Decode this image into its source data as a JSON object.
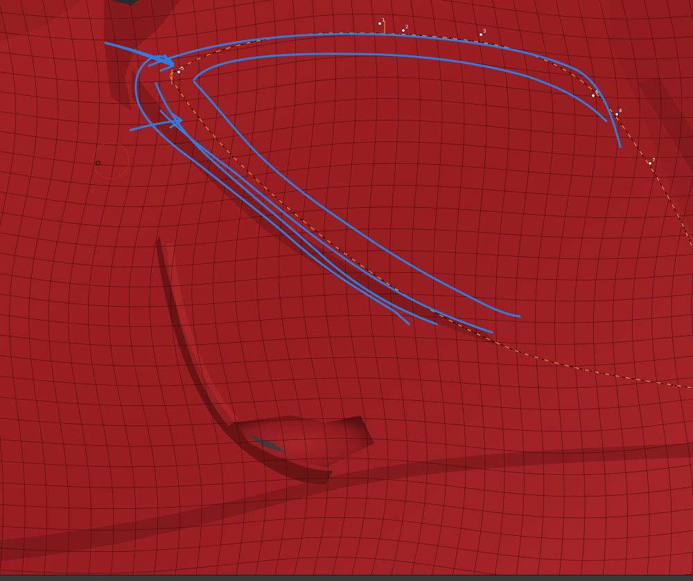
{
  "colors": {
    "mesh_base": "#9e1f22",
    "mesh_light": "#b0272a",
    "mesh_dark": "#6d1416",
    "wire": "#3a0a0b",
    "annotation_stroke": "#2f7de1",
    "guide_stroke": "#f19a3e",
    "guide_dark": "#2a0505",
    "brush_cursor": "#d42a2a",
    "status_bar": "#3a3a3a"
  },
  "icons": {
    "brush_cursor": "brush-cursor-icon",
    "guide_points": "control-point-icon"
  },
  "viewport": {
    "mode": "sculpt-retopology",
    "curve_points": [
      {
        "label": "1"
      },
      {
        "label": "2"
      },
      {
        "label": "3"
      },
      {
        "label": "4"
      },
      {
        "label": "5"
      },
      {
        "label": "6"
      },
      {
        "label": "7"
      }
    ]
  }
}
